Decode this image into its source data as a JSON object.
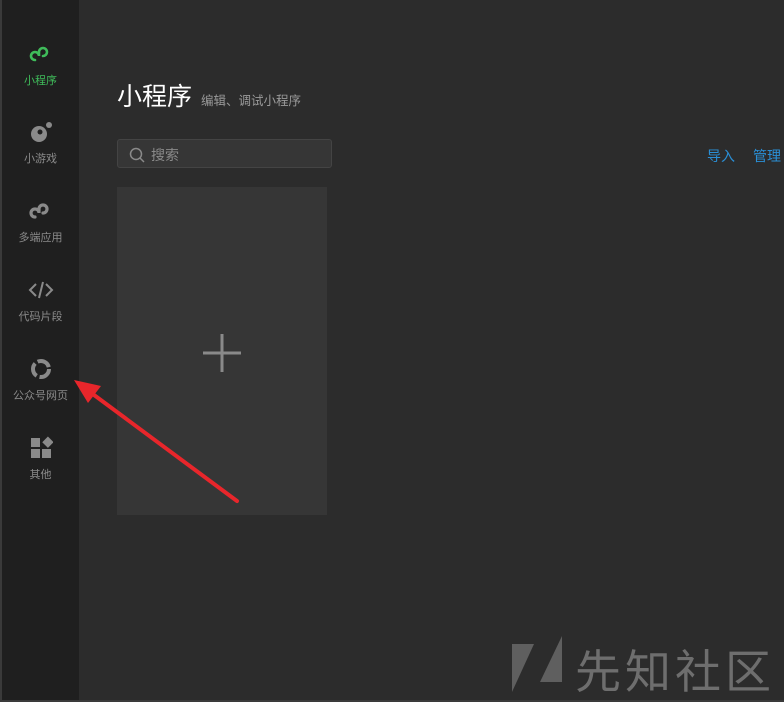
{
  "sidebar": {
    "items": [
      {
        "label": "小程序",
        "icon": "miniprogram-icon",
        "active": true
      },
      {
        "label": "小游戏",
        "icon": "minigame-icon"
      },
      {
        "label": "多端应用",
        "icon": "multiplatform-icon"
      },
      {
        "label": "代码片段",
        "icon": "code-icon"
      },
      {
        "label": "公众号网页",
        "icon": "webpage-icon"
      },
      {
        "label": "其他",
        "icon": "grid-icon"
      }
    ]
  },
  "main": {
    "title": "小程序",
    "subtitle": "编辑、调试小程序",
    "search_placeholder": "搜索",
    "import_label": "导入",
    "manage_label": "管理",
    "new_project_icon": "plus-icon"
  },
  "watermark": {
    "text": "先知社区"
  },
  "annotation": {
    "arrow_color": "#e8262b",
    "target": "公众号网页"
  },
  "colors": {
    "accent": "#3fbb5a",
    "link": "#2a8fd6"
  }
}
